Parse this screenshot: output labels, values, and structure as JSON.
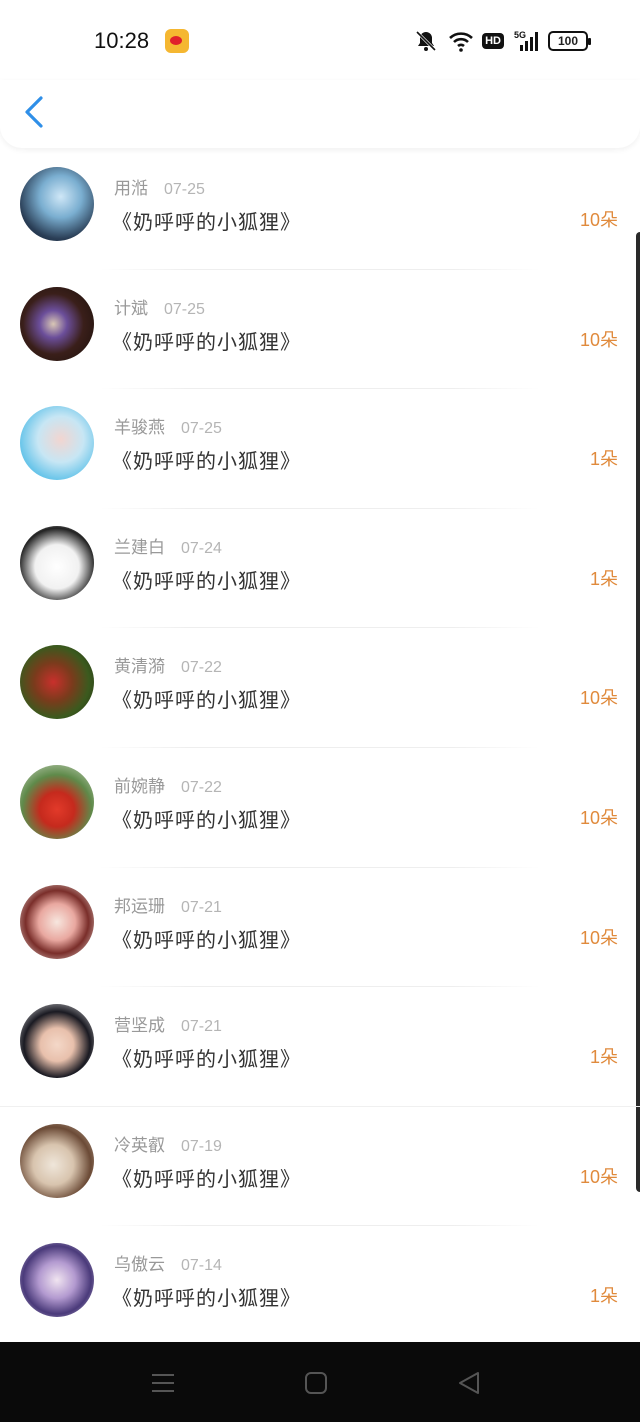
{
  "status": {
    "time": "10:28",
    "battery": "100",
    "hd": "HD",
    "network": "5G"
  },
  "nav": {
    "back_icon": "chevron-left-icon"
  },
  "colors": {
    "accent": "#e08a3c",
    "back": "#2f8fe8"
  },
  "records": [
    {
      "name": "用湉",
      "date": "07-25",
      "title": "《奶呼呼的小狐狸》",
      "amount": "10朵"
    },
    {
      "name": "计斌",
      "date": "07-25",
      "title": "《奶呼呼的小狐狸》",
      "amount": "10朵"
    },
    {
      "name": "羊骏燕",
      "date": "07-25",
      "title": "《奶呼呼的小狐狸》",
      "amount": "1朵"
    },
    {
      "name": "兰建白",
      "date": "07-24",
      "title": "《奶呼呼的小狐狸》",
      "amount": "1朵"
    },
    {
      "name": "黄清漪",
      "date": "07-22",
      "title": "《奶呼呼的小狐狸》",
      "amount": "10朵"
    },
    {
      "name": "前婉静",
      "date": "07-22",
      "title": "《奶呼呼的小狐狸》",
      "amount": "10朵"
    },
    {
      "name": "邦运珊",
      "date": "07-21",
      "title": "《奶呼呼的小狐狸》",
      "amount": "10朵"
    },
    {
      "name": "营坚成",
      "date": "07-21",
      "title": "《奶呼呼的小狐狸》",
      "amount": "1朵"
    },
    {
      "name": "冷英叡",
      "date": "07-19",
      "title": "《奶呼呼的小狐狸》",
      "amount": "10朵"
    },
    {
      "name": "乌傲云",
      "date": "07-14",
      "title": "《奶呼呼的小狐狸》",
      "amount": "1朵"
    }
  ]
}
